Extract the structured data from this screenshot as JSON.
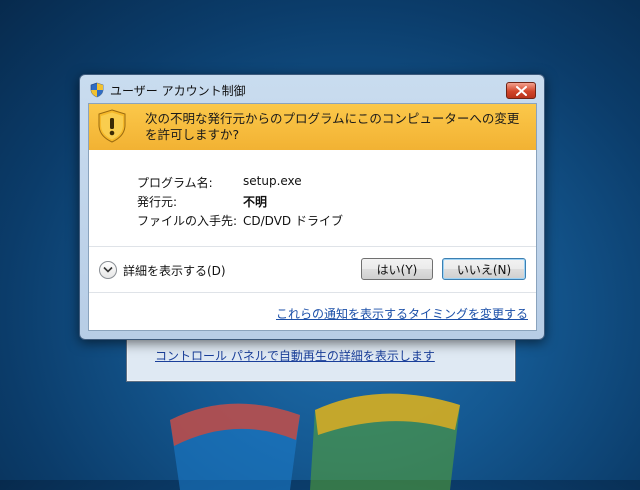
{
  "background_window": {
    "link_text": "コントロール パネルで自動再生の詳細を表示します"
  },
  "dialog": {
    "title": "ユーザー アカウント制御",
    "banner_text": "次の不明な発行元からのプログラムにこのコンピューターへの変更を許可しますか?",
    "program_label": "プログラム名:",
    "program_value": "setup.exe",
    "publisher_label": "発行元:",
    "publisher_value": "不明",
    "source_label": "ファイルの入手先:",
    "source_value": "CD/DVD ドライブ",
    "details_label": "詳細を表示する(D)",
    "yes_label": "はい(Y)",
    "no_label": "いいえ(N)",
    "notification_link": "これらの通知を表示するタイミングを変更する"
  },
  "colors": {
    "banner": "#f2b233",
    "link": "#1b4fa8",
    "close": "#d2462a"
  }
}
